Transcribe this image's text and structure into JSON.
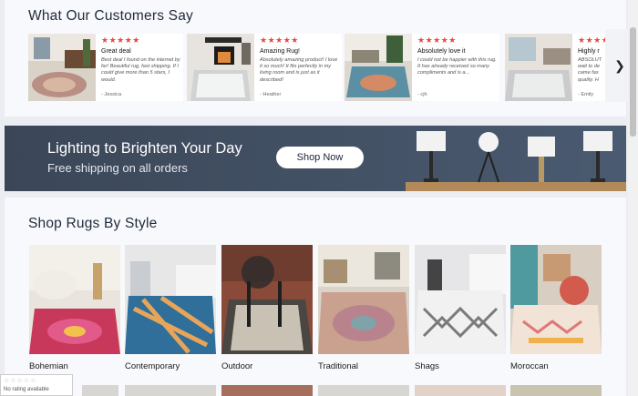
{
  "reviews": {
    "title": "What Our Customers Say",
    "next_icon": "chevron-right-icon",
    "items": [
      {
        "stars": "★★★★★",
        "title": "Great deal",
        "body": "Best deal I found on the internet by far! Beautiful rug, fast shipping. If I could give more than 5 stars, I would.",
        "author": "- Jessica"
      },
      {
        "stars": "★★★★★",
        "title": "Amazing Rug!",
        "body": "Absolutely amazing product! I love it so much! It fits perfectly in my living room and is just as it described!",
        "author": "- Heather"
      },
      {
        "stars": "★★★★★",
        "title": "Absolutely love it",
        "body": "I could not be happier with this rug. It has already received so many compliments and is a...",
        "author": "- cjh"
      },
      {
        "stars": "★★★★★",
        "title": "Highly r",
        "body": "ABSOLUT wait to de came fas quality. H",
        "author": "- Emily"
      }
    ]
  },
  "banner": {
    "title": "Lighting to Brighten Your Day",
    "subtitle": "Free shipping on all orders",
    "cta": "Shop Now"
  },
  "styles": {
    "title": "Shop Rugs By Style",
    "items": [
      {
        "label": "Bohemian"
      },
      {
        "label": "Contemporary"
      },
      {
        "label": "Outdoor"
      },
      {
        "label": "Traditional"
      },
      {
        "label": "Shags"
      },
      {
        "label": "Moroccan"
      }
    ]
  },
  "rating_badge": {
    "stars": "☆☆☆☆☆",
    "text": "No rating available"
  },
  "colors": {
    "star": "#e8473f",
    "banner_bg": "#3c4a5c",
    "page_bg": "#ecedf2"
  }
}
